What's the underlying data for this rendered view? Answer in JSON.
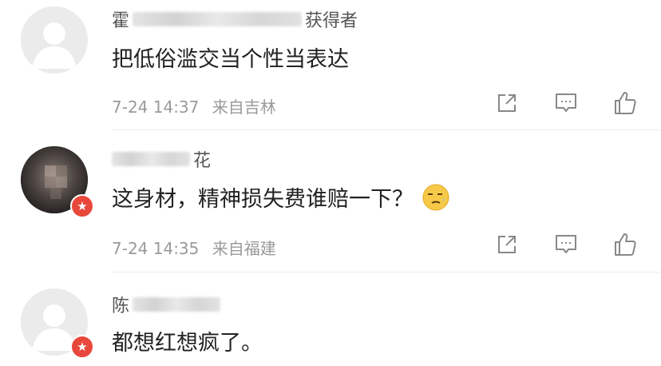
{
  "comments": [
    {
      "nickname_visible_start": "霍",
      "nickname_visible_end": "获得者",
      "text": "把低俗滥交当个性当表达",
      "time": "7-24 14:37",
      "location": "来自吉林",
      "avatar": "default-avatar",
      "verified": false
    },
    {
      "nickname_visible_start": "",
      "nickname_visible_end": "花",
      "text": "这身材，精神损失费谁赔一下？",
      "emoji": "awkward-smile-emoji",
      "time": "7-24 14:35",
      "location": "来自福建",
      "avatar": "photo-avatar",
      "verified": true
    },
    {
      "nickname_visible_start": "陈",
      "nickname_visible_end": "",
      "text": "都想红想疯了。",
      "avatar": "default-avatar",
      "verified": true
    }
  ],
  "icons": {
    "share": "share-icon",
    "comment": "comment-icon",
    "like": "thumbs-up-icon"
  },
  "colors": {
    "verified_badge": "#e8483b",
    "meta_text": "#9a9a9a",
    "body_text": "#222222"
  }
}
